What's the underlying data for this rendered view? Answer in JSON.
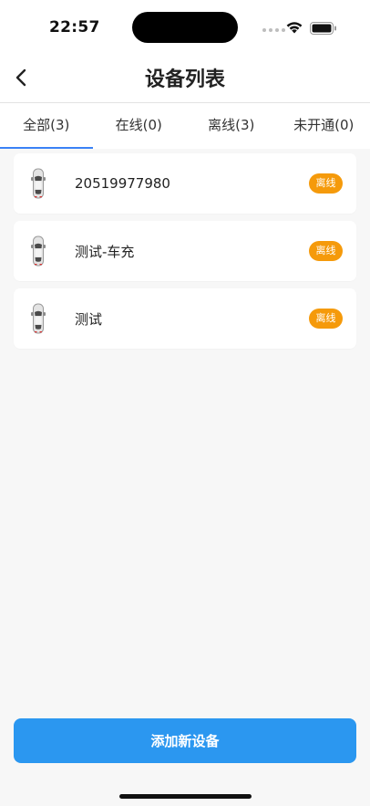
{
  "status_bar": {
    "time": "22:57",
    "icons": [
      "signal-dots-icon",
      "wifi-icon",
      "battery-icon"
    ]
  },
  "nav": {
    "title": "设备列表",
    "back_icon": "chevron-left-icon"
  },
  "tabs": [
    {
      "label": "全部(3)",
      "active": true
    },
    {
      "label": "在线(0)",
      "active": false
    },
    {
      "label": "离线(3)",
      "active": false
    },
    {
      "label": "未开通(0)",
      "active": false
    }
  ],
  "devices": [
    {
      "name": "20519977980",
      "status": "离线",
      "icon": "car-icon"
    },
    {
      "name": "测试-车充",
      "status": "离线",
      "icon": "car-icon"
    },
    {
      "name": "测试",
      "status": "离线",
      "icon": "car-icon"
    }
  ],
  "footer": {
    "add_button_label": "添加新设备"
  },
  "colors": {
    "accent": "#2b97f0",
    "tab_indicator": "#3b82f6",
    "offline_badge": "#f59a0b",
    "background": "#f7f7f7"
  }
}
